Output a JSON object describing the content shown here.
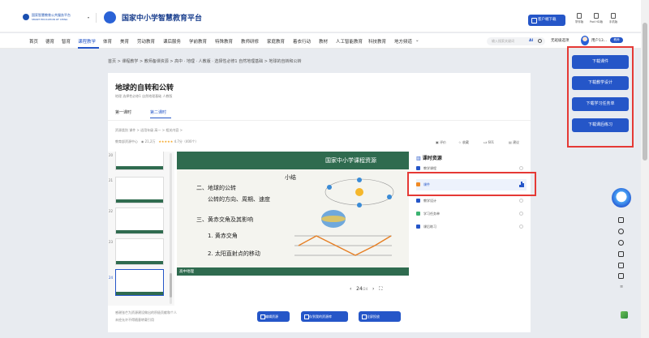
{
  "header": {
    "gov_logo_text": "国家智慧教育公共服务平台",
    "gov_logo_sub": "SMART EDUCATION OF CHINA",
    "platform_title": "国家中小学智慧教育平台",
    "download_client": "客户端下载",
    "icons": [
      {
        "label": "学伴版",
        "icon": "tablet-icon"
      },
      {
        "label": "Pad HD版",
        "icon": "pad-icon"
      },
      {
        "label": "手机版",
        "icon": "phone-icon"
      }
    ]
  },
  "nav": {
    "items": [
      "首页",
      "德育",
      "智育",
      "课程教学",
      "体育",
      "美育",
      "劳动教育",
      "课后服务",
      "学前教育",
      "特殊教育",
      "教师研修",
      "家庭教育",
      "着衣行动",
      "教材",
      "人工智能教育",
      "科技教育",
      "地方频道"
    ],
    "active_index": 3,
    "search_placeholder": "输入搜索关键词",
    "search_ai": "AI",
    "no_child": "无班级选项",
    "user_name": "用户13...",
    "user_badge": "教师"
  },
  "breadcrumb": "首页 > 课程教学 > 教师备课资源 > 高中 · 地理 · 人教版 · 选择性必修1 自然地理基础 > 地球的自转和公转",
  "resource": {
    "title": "地球的自转和公转",
    "meta": "地理  选择性必修1 自然地理基础  人教版",
    "lesson_tabs": [
      "第一课时",
      "第二课时"
    ],
    "active_lesson": 1,
    "info_line1": "资源类别  课件  >   适用年级  高一  >   相关内容  >",
    "publisher": "教育部资源中心",
    "views": "21,2万",
    "stars": "★★★★★",
    "rating": "4.7分（400个）",
    "stats": [
      {
        "label": "评价",
        "icon": "comment-icon"
      },
      {
        "label": "收藏",
        "icon": "star-icon"
      },
      {
        "label": "601",
        "icon": "thumb-up-icon"
      },
      {
        "label": "建议",
        "icon": "feedback-icon"
      }
    ]
  },
  "thumbnails": {
    "numbers": [
      "20",
      "21",
      "22",
      "23",
      "24"
    ],
    "active": "24"
  },
  "slide": {
    "banner": "国家中小学课程资源",
    "heading": "小结",
    "line1": "二、地球的公转",
    "line2": "公转的方向、周期、速度",
    "line3": "三、黄赤交角及其影响",
    "line4": "1. 黄赤交角",
    "line5": "2. 太阳直射点的移动",
    "footer_label": "高中地理",
    "page_current": "24",
    "page_total": "/24"
  },
  "panel": {
    "title": "课时资源",
    "items": [
      {
        "label": "教学课程",
        "icon": "video-icon",
        "color": "#2556c8"
      },
      {
        "label": "课件",
        "icon": "slides-icon",
        "color": "#f08a24"
      },
      {
        "label": "教学设计",
        "icon": "design-icon",
        "color": "#2556c8"
      },
      {
        "label": "学习任务单",
        "icon": "task-icon",
        "color": "#3cb371"
      },
      {
        "label": "课后练习",
        "icon": "exercise-icon",
        "color": "#2556c8"
      }
    ],
    "active_index": 1
  },
  "bottom": {
    "note1": "感谢张芒为资源建设做出的积极贡献和个人",
    "note2": "未经允许不得随意转载引用",
    "buttons": [
      "编辑资源",
      "存到我的资源库",
      "全屏投放"
    ]
  },
  "downloads": [
    "下载课件",
    "下载教学设计",
    "下载学习任务单",
    "下载课后练习"
  ],
  "side_icons": [
    "home-icon",
    "help-icon",
    "chevron-circle-icon",
    "document-icon",
    "copy-icon",
    "message-icon"
  ],
  "side_more": "≡"
}
